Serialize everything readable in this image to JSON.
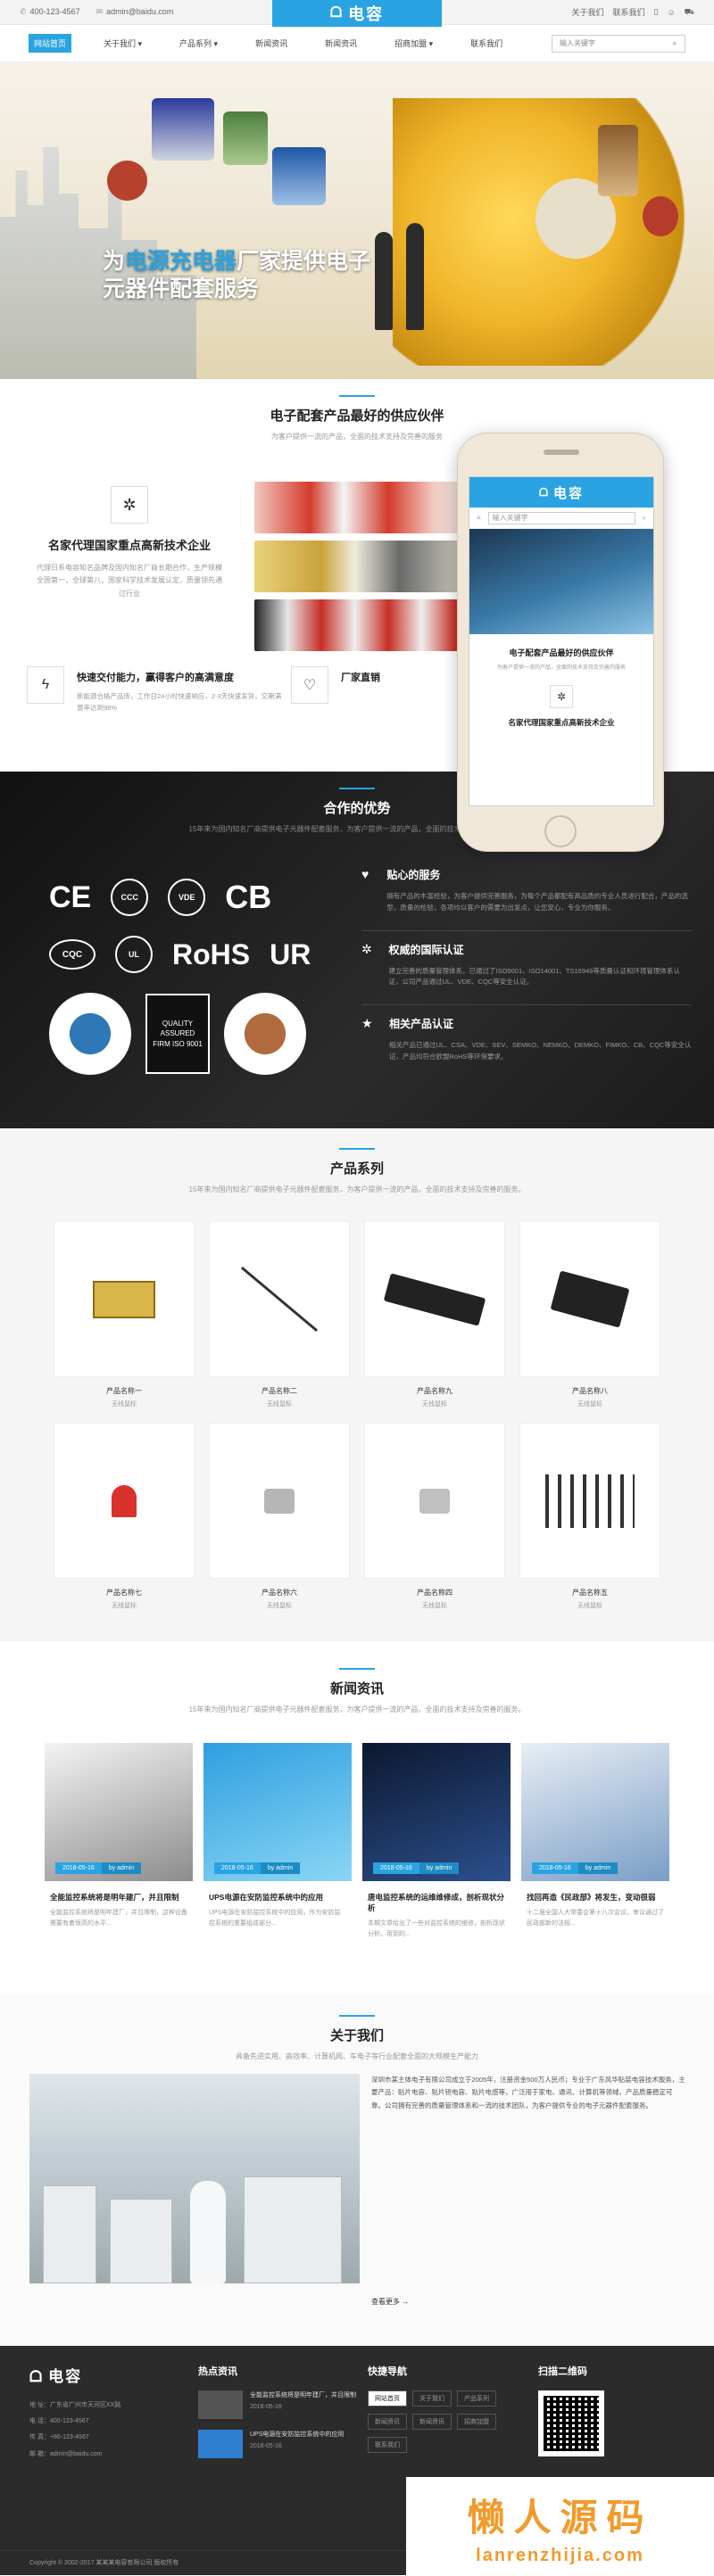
{
  "topbar": {
    "phone": "400-123-4567",
    "email": "admin@baidu.com",
    "links": [
      "关于我们",
      "联系我们"
    ]
  },
  "brand": {
    "name": "电容",
    "color": "#2aa3e2"
  },
  "nav": {
    "items": [
      "网站首页",
      "关于我们 ▾",
      "产品系列 ▾",
      "新闻资讯",
      "新闻资讯",
      "招商加盟 ▾",
      "联系我们"
    ],
    "search_placeholder": "输入关键字"
  },
  "banner": {
    "line1_pre": "为",
    "line1_highlight": "电源充电器",
    "line1_post": "厂家提供电子",
    "line2": "元器件配套服务"
  },
  "intro": {
    "title": "电子配套产品最好的供应伙伴",
    "subtitle": "为客户提供一流的产品，全面的技术支持及完善的服务",
    "feature1_title": "名家代理国家重点高新技术企业",
    "feature1_desc": "代理日系电容知名品牌及国内知名厂商长期合作，生产规模全国第一，全球第八，国家科学技术发展认定，质量领先通过行业",
    "feature2_title": "快速交付能力，赢得客户的高满意度",
    "feature2_desc": "新能源合格产品库，工作日24小时快速响应，2-3天快速发货，交期满意率达到98%",
    "feature3_title": "厂家直销",
    "feature3_desc": ""
  },
  "phone_mock": {
    "logo": "电容",
    "search": "输入关键字",
    "title": "电子配套产品最好的供应伙伴",
    "subtitle": "为客户提供一流的产品，全面的技术支持及完善的服务",
    "feature": "名家代理国家重点高新技术企业"
  },
  "advantages": {
    "title": "合作的优势",
    "subtitle": "15年来为国内知名厂商提供电子元器件配套服务，为客户提供一流的产品，全面的技术支持及完善的服务。",
    "certs": [
      "CE",
      "CCC",
      "VDE",
      "CB",
      "CQC",
      "UL",
      "RoHS",
      "UR"
    ],
    "badge_text": "QUALITY ASSURED FIRM ISO 9001",
    "items": [
      {
        "title": "贴心的服务",
        "desc": "拥有产品的丰富经验，为客户提供完善服务，为每个产品都配有高品质的专业人员进行配合，产品的选型，质量的检验，各项均以客户的需要为出发点，让您安心，专业为你服务。"
      },
      {
        "title": "权威的国际认证",
        "desc": "建立完善的质量管理体系，已通过了ISO9001、ISO14001、TS16949等质量认证和环境管理体系认证，公司产品通过UL、VDE、CQC等安全认证。"
      },
      {
        "title": "相关产品认证",
        "desc": "相关产品已通过UL、CSA、VDE、SEV、SEMKO、NEMKO、DEMKO、FIMKO、CB、CQC等安全认证，产品均符合欧盟RoHS等环保要求。"
      }
    ]
  },
  "products": {
    "title": "产品系列",
    "subtitle": "15年来为国内知名厂商提供电子元器件配套服务，为客户提供一流的产品，全面的技术支持及完善的服务。",
    "items": [
      {
        "name": "产品名称一",
        "sub": "无线鼠标"
      },
      {
        "name": "产品名称二",
        "sub": "无线鼠标"
      },
      {
        "name": "产品名称九",
        "sub": "无线鼠标"
      },
      {
        "name": "产品名称八",
        "sub": "无线鼠标"
      },
      {
        "name": "产品名称七",
        "sub": "无线鼠标"
      },
      {
        "name": "产品名称六",
        "sub": "无线鼠标"
      },
      {
        "name": "产品名称四",
        "sub": "无线鼠标"
      },
      {
        "name": "产品名称五",
        "sub": "无线鼠标"
      }
    ]
  },
  "news": {
    "title": "新闻资讯",
    "subtitle": "15年来为国内知名厂商提供电子元器件配套服务，为客户提供一流的产品，全面的技术支持及完善的服务。",
    "items": [
      {
        "date": "2018-05-16",
        "by": "by admin",
        "title": "全能监控系统将是明年建厂，并且限制",
        "desc": "全能监控系统将是明年建厂，并且限制，这种设备需要有着很高的水平..."
      },
      {
        "date": "2018-05-16",
        "by": "by admin",
        "title": "UPS电源在安防监控系统中的应用",
        "desc": "UPS电源在安防监控系统中的应用，作为安防监控系统的重要组成部分..."
      },
      {
        "date": "2018-05-16",
        "by": "by admin",
        "title": "唐电监控系统的运维维修成，剖析现状分析",
        "desc": "本期文章给出了一些对监控系统的维修，剖析现状分析，用到的..."
      },
      {
        "date": "2018-05-16",
        "by": "by admin",
        "title": "找回再造《民政部》将发生，变动很弱",
        "desc": "十二届全国人大常委会第十八次会议，审议通过了民政部新的法规..."
      }
    ]
  },
  "about": {
    "title": "关于我们",
    "subtitle": "具备先进实用、高效率、计算机网、车电子等行业配套全面的大规模生产能力",
    "text": "深圳市某主体电子有限公司成立于2005年，注册资金500万人民币；专业于广东风华贴装电容技术服务，主要产品：贴片电容、贴片钽电容、贴片电感等，广泛用于家电、通讯、计算机等领域，产品质量稳定可靠。公司拥有完善的质量管理体系和一流的技术团队，为客户提供专业的电子元器件配套服务。",
    "more": "查看更多 →"
  },
  "footer": {
    "logo": "电容",
    "info": [
      "地 址：广东省广州市天河区XX路",
      "电 话：400-123-4567",
      "传 真：+86-123-4567",
      "邮 箱：admin@baidu.com"
    ],
    "hot_title": "热点资讯",
    "hot": [
      {
        "title": "全能监控系统将是明年建厂，并且限制",
        "date": "2018-05-16"
      },
      {
        "title": "UPS电源在安防监控系统中的应用",
        "date": "2018-05-16"
      }
    ],
    "nav_title": "快捷导航",
    "nav": [
      "网站首页",
      "关于我们",
      "产品系列",
      "新闻资讯",
      "新闻资讯",
      "招商加盟",
      "联系我们"
    ],
    "qr_title": "扫描二维码",
    "copyright": "Copyright © 2002-2017 某某某电容有限公司 版权所有"
  },
  "watermark": {
    "big": "懒人源码",
    "small": "lanrenzhijia.com"
  }
}
